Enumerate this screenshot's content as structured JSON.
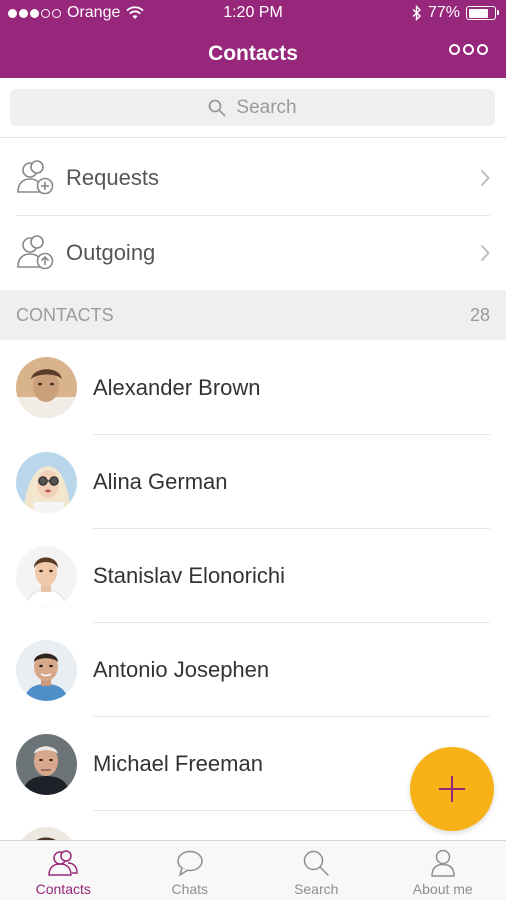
{
  "status_bar": {
    "carrier": "Orange",
    "time": "1:20 PM",
    "battery": "77%",
    "battery_level": 0.77,
    "signal_bars": 3
  },
  "nav": {
    "title": "Contacts",
    "more_icon": "more-circles-icon"
  },
  "search": {
    "placeholder": "Search",
    "icon": "search-icon"
  },
  "requests": [
    {
      "label": "Requests",
      "icon": "add-contact-icon"
    },
    {
      "label": "Outgoing",
      "icon": "outgoing-contact-icon"
    }
  ],
  "section": {
    "label": "CONTACTS",
    "count": "28"
  },
  "contacts": [
    {
      "name": "Alexander Brown"
    },
    {
      "name": "Alina German"
    },
    {
      "name": "Stanislav Elonorichi"
    },
    {
      "name": "Antonio Josephen"
    },
    {
      "name": "Michael Freeman"
    }
  ],
  "fab": {
    "icon": "plus-icon"
  },
  "tabs": [
    {
      "label": "Contacts",
      "icon": "contacts-icon",
      "active": true
    },
    {
      "label": "Chats",
      "icon": "chat-bubble-icon",
      "active": false
    },
    {
      "label": "Search",
      "icon": "search-icon",
      "active": false
    },
    {
      "label": "About me",
      "icon": "person-icon",
      "active": false
    }
  ],
  "colors": {
    "brand": "#97277a",
    "fab": "#f7b217",
    "section_bg": "#efefef"
  }
}
